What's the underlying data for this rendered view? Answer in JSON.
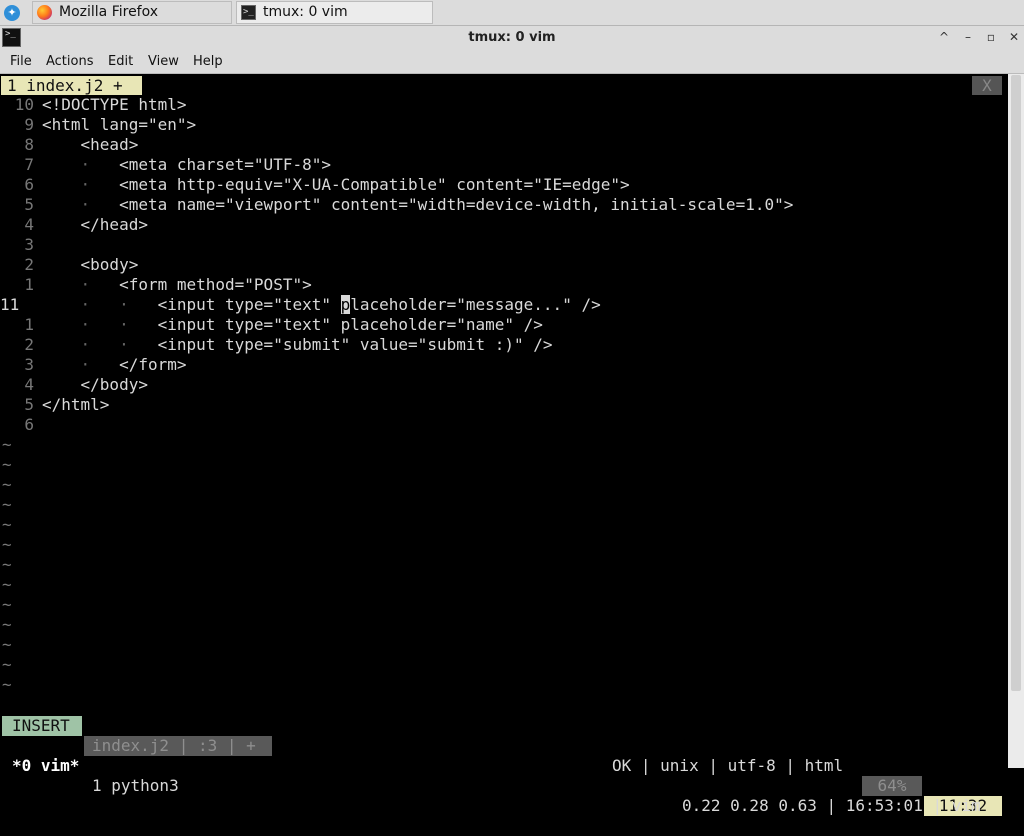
{
  "taskbar": {
    "tasks": [
      {
        "label": "Mozilla Firefox",
        "icon": "firefox-icon"
      },
      {
        "label": "tmux: 0 vim",
        "icon": "terminal-icon"
      }
    ]
  },
  "window": {
    "title": "tmux: 0 vim",
    "controls": [
      "^",
      "–",
      "▫",
      "✕"
    ]
  },
  "menubar": {
    "items": [
      "File",
      "Actions",
      "Edit",
      "View",
      "Help"
    ]
  },
  "vim": {
    "tab_label": "1 index.j2 +",
    "close_label": "X",
    "lines": [
      {
        "num": "10",
        "indent": "",
        "text": "<!DOCTYPE html>"
      },
      {
        "num": "9",
        "indent": "",
        "text": "<html lang=\"en\">"
      },
      {
        "num": "8",
        "indent": "    ",
        "text": "<head>"
      },
      {
        "num": "7",
        "indent": "    ·   ",
        "text": "<meta charset=\"UTF-8\">"
      },
      {
        "num": "6",
        "indent": "    ·   ",
        "text": "<meta http-equiv=\"X-UA-Compatible\" content=\"IE=edge\">"
      },
      {
        "num": "5",
        "indent": "    ·   ",
        "text": "<meta name=\"viewport\" content=\"width=device-width, initial-scale=1.0\">"
      },
      {
        "num": "4",
        "indent": "    ",
        "text": "</head>"
      },
      {
        "num": "3",
        "indent": "",
        "text": ""
      },
      {
        "num": "2",
        "indent": "    ",
        "text": "<body>"
      },
      {
        "num": "1",
        "indent": "    ·   ",
        "text": "<form method=\"POST\">"
      },
      {
        "num": "11",
        "indent": "    ·   ·   ",
        "text": "<input type=\"text\" placeholder=\"message...\" />",
        "current": true
      },
      {
        "num": "1",
        "indent": "    ·   ·   ",
        "text": "<input type=\"text\" placeholder=\"name\" />"
      },
      {
        "num": "2",
        "indent": "    ·   ·   ",
        "text": "<input type=\"submit\" value=\"submit :)\" />"
      },
      {
        "num": "3",
        "indent": "    ·   ",
        "text": "</form>"
      },
      {
        "num": "4",
        "indent": "    ",
        "text": "</body>"
      },
      {
        "num": "5",
        "indent": "",
        "text": "</html>"
      },
      {
        "num": "6",
        "indent": "",
        "text": ""
      }
    ],
    "cursor_line_prefix": "<input type=\"text\" ",
    "cursor_char": "p",
    "cursor_line_suffix": "laceholder=\"message...\" />",
    "tilde": "~",
    "status": {
      "mode": "INSERT",
      "file": "index.j2 | :3 | +",
      "right": "OK | unix | utf-8 | html",
      "percent": "64%",
      "position": "11:32"
    }
  },
  "tmux": {
    "active_window": "*0 vim*",
    "other_window": "1 python3",
    "right": "0.22 0.28 0.63 | 16:53:01 | vim"
  }
}
